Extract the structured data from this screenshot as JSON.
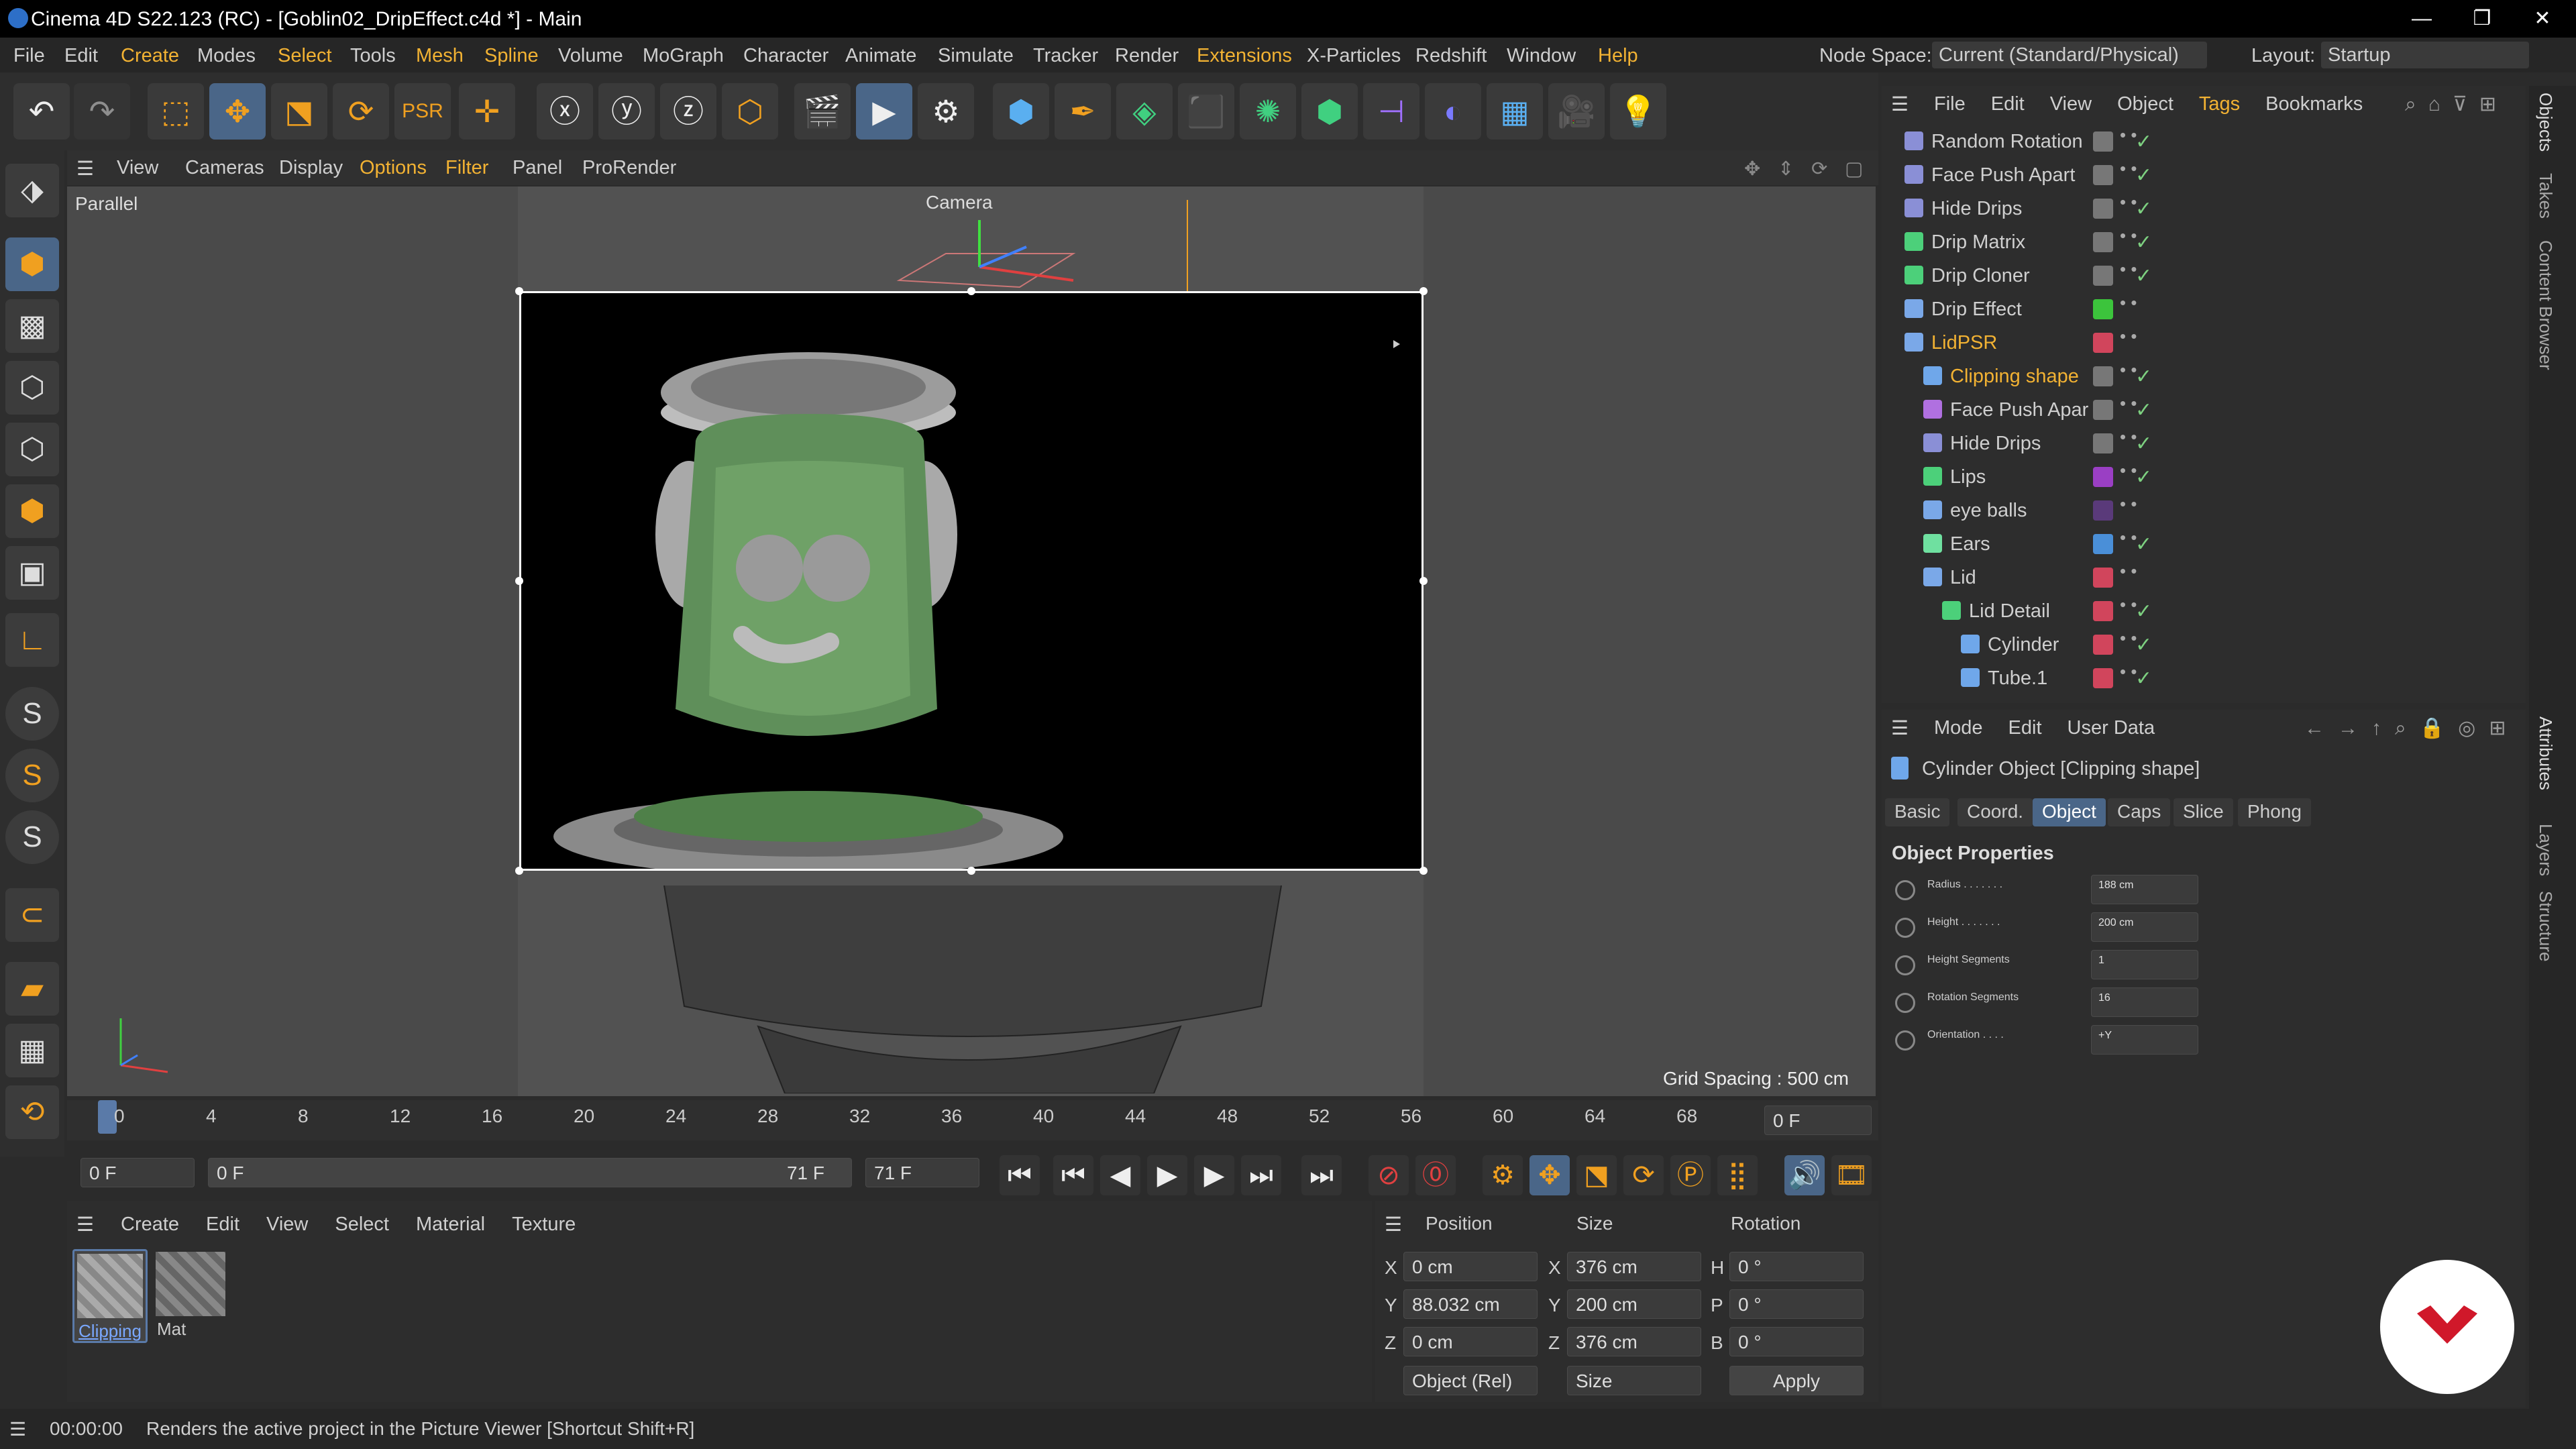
{
  "window": {
    "title": "Cinema 4D S22.123 (RC) - [Goblin02_DripEffect.c4d *] - Main",
    "controls": [
      "—",
      "❐",
      "✕"
    ]
  },
  "menubar": {
    "items": [
      "File",
      "Edit",
      "Create",
      "Modes",
      "Select",
      "Tools",
      "Mesh",
      "Spline",
      "Volume",
      "MoGraph",
      "Character",
      "Animate",
      "Simulate",
      "Tracker",
      "Render",
      "Extensions",
      "X-Particles",
      "Redshift",
      "Window",
      "Help"
    ],
    "node_space_label": "Node Space:",
    "node_space_value": "Current (Standard/Physical)",
    "layout_label": "Layout:",
    "layout_value": "Startup"
  },
  "viewport": {
    "menu": [
      "View",
      "Cameras",
      "Display",
      "Options",
      "Filter",
      "Panel",
      "ProRender"
    ],
    "mode_label": "Parallel",
    "camera_label": "Camera",
    "grid_spacing": "Grid Spacing : 500 cm"
  },
  "timeline": {
    "ticks": [
      "0",
      "4",
      "8",
      "12",
      "16",
      "20",
      "24",
      "28",
      "32",
      "36",
      "40",
      "44",
      "48",
      "52",
      "56",
      "60",
      "64",
      "68",
      "7"
    ],
    "current_frame": "0 F",
    "start_frame": "0 F",
    "range_start": "0 F",
    "range_end": "71 F",
    "end_frame": "71 F"
  },
  "material_manager": {
    "menu": [
      "Create",
      "Edit",
      "View",
      "Select",
      "Material",
      "Texture"
    ],
    "materials": [
      {
        "name": "Clipping",
        "selected": true
      },
      {
        "name": "Mat",
        "selected": false
      }
    ]
  },
  "coords": {
    "headers": [
      "Position",
      "Size",
      "Rotation"
    ],
    "rows": [
      {
        "axis": "X",
        "pos": "0 cm",
        "saxis": "X",
        "size": "376 cm",
        "raxis": "H",
        "rot": "0 °"
      },
      {
        "axis": "Y",
        "pos": "88.032 cm",
        "saxis": "Y",
        "size": "200 cm",
        "raxis": "P",
        "rot": "0 °"
      },
      {
        "axis": "Z",
        "pos": "0 cm",
        "saxis": "Z",
        "size": "376 cm",
        "raxis": "B",
        "rot": "0 °"
      }
    ],
    "mode": "Object (Rel)",
    "size_mode": "Size",
    "apply": "Apply"
  },
  "status": {
    "time": "00:00:00",
    "message": "Renders the active project in the Picture Viewer [Shortcut Shift+R]"
  },
  "object_manager": {
    "menu": [
      "File",
      "Edit",
      "View",
      "Object",
      "Tags",
      "Bookmarks"
    ],
    "objects": [
      {
        "name": "Random Rotation",
        "indent": 0,
        "icon_color": "#8a8fd6",
        "layer": "#777777",
        "check": true
      },
      {
        "name": "Face Push Apart",
        "indent": 0,
        "icon_color": "#8a8fd6",
        "layer": "#777777",
        "check": true
      },
      {
        "name": "Hide Drips",
        "indent": 0,
        "icon_color": "#8a8fd6",
        "layer": "#777777",
        "check": true
      },
      {
        "name": "Drip Matrix",
        "indent": 0,
        "icon_color": "#4cd07a",
        "layer": "#777777",
        "check": true
      },
      {
        "name": "Drip Cloner",
        "indent": 0,
        "icon_color": "#4cd07a",
        "layer": "#777777",
        "check": true
      },
      {
        "name": "Drip Effect",
        "indent": 0,
        "icon_color": "#7aa8e8",
        "layer": "#3cc43c",
        "check": false
      },
      {
        "name": "LidPSR",
        "indent": 0,
        "icon_color": "#7aa8e8",
        "layer": "#d1455c",
        "check": false,
        "orange": true
      },
      {
        "name": "Clipping shape",
        "indent": 1,
        "icon_color": "#6fa7ea",
        "layer": "#777777",
        "check": true,
        "orange": true
      },
      {
        "name": "Face Push Apar",
        "indent": 1,
        "icon_color": "#b070e0",
        "layer": "#777777",
        "check": true
      },
      {
        "name": "Hide Drips",
        "indent": 1,
        "icon_color": "#8a8fd6",
        "layer": "#777777",
        "check": true
      },
      {
        "name": "Lips",
        "indent": 1,
        "icon_color": "#4cd07a",
        "layer": "#9a3fc4",
        "check": true
      },
      {
        "name": "eye balls",
        "indent": 1,
        "icon_color": "#7aa8e8",
        "layer": "#5a3a7a",
        "check": false
      },
      {
        "name": "Ears",
        "indent": 1,
        "icon_color": "#6fe0a0",
        "layer": "#4a8fd8",
        "check": true
      },
      {
        "name": "Lid",
        "indent": 1,
        "icon_color": "#7aa8e8",
        "layer": "#d1455c",
        "check": false
      },
      {
        "name": "Lid Detail",
        "indent": 2,
        "icon_color": "#4cd07a",
        "layer": "#d1455c",
        "check": true
      },
      {
        "name": "Cylinder",
        "indent": 3,
        "icon_color": "#6fa7ea",
        "layer": "#d1455c",
        "check": true
      },
      {
        "name": "Tube.1",
        "indent": 3,
        "icon_color": "#6fa7ea",
        "layer": "#d1455c",
        "check": true
      }
    ]
  },
  "attributes": {
    "menu": [
      "Mode",
      "Edit",
      "User Data"
    ],
    "object_title": "Cylinder Object [Clipping shape]",
    "tabs": [
      "Basic",
      "Coord.",
      "Object",
      "Caps",
      "Slice",
      "Phong"
    ],
    "active_tab": "Object",
    "section": "Object Properties",
    "props": [
      {
        "label": "Radius . . . . . . .",
        "value": "188 cm"
      },
      {
        "label": "Height . . . . . . .",
        "value": "200 cm"
      },
      {
        "label": "Height Segments",
        "value": "1"
      },
      {
        "label": "Rotation Segments",
        "value": "16"
      },
      {
        "label": "Orientation . . . .",
        "value": "+Y"
      }
    ]
  },
  "side_tabs": [
    "Objects",
    "Takes",
    "Content Browser",
    "Attributes",
    "Layers",
    "Structure"
  ]
}
